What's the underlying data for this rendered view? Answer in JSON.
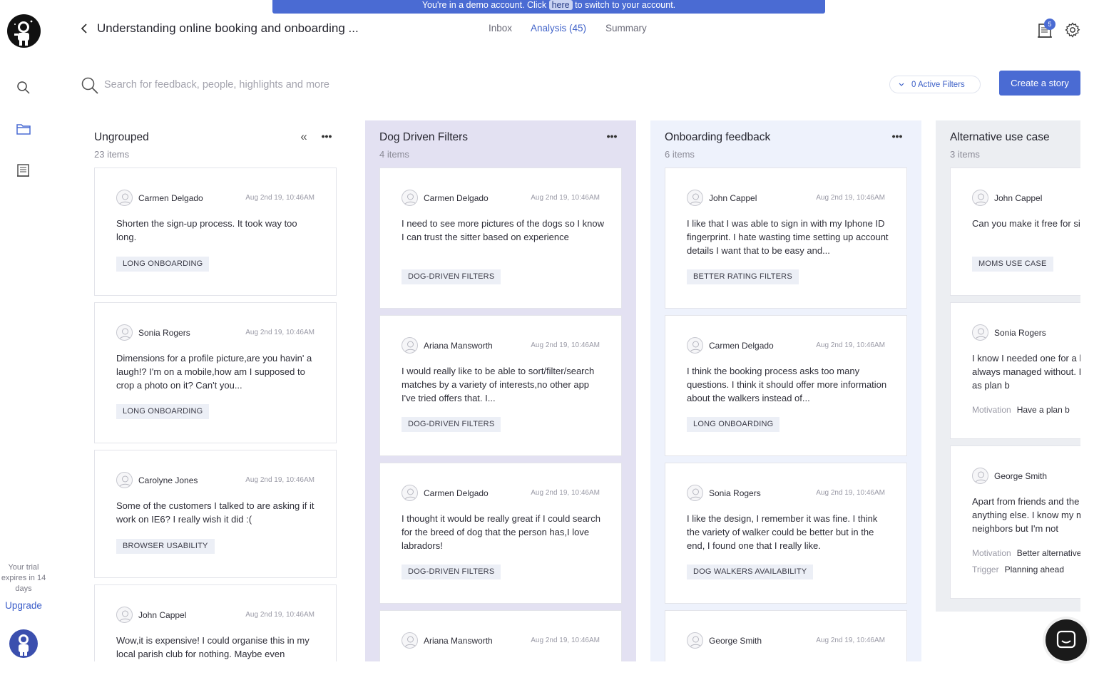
{
  "banner": {
    "text_before": "You're in a demo account. Click",
    "link": "here",
    "text_after": "to switch to your account."
  },
  "header": {
    "title": "Understanding online booking and onboarding ...",
    "tabs": [
      {
        "label": "Inbox",
        "active": false
      },
      {
        "label": "Analysis (45)",
        "active": true
      },
      {
        "label": "Summary",
        "active": false
      }
    ],
    "notification_count": "5"
  },
  "search": {
    "placeholder": "Search for feedback, people, highlights and more",
    "value": ""
  },
  "filters": {
    "label": "0 Active Filters"
  },
  "create_story": {
    "label": "Create a story"
  },
  "sidebar": {
    "trial_text": "Your trial expires in 14 days",
    "upgrade_label": "Upgrade"
  },
  "colors": {
    "accent": "#4a6bd3",
    "col_purple": "#e3e1f2",
    "col_blue": "#eef2fc",
    "col_gray": "#eceef2"
  },
  "columns": [
    {
      "title": "Ungrouped",
      "count": "23 items",
      "cards": [
        {
          "name": "Carmen Delgado",
          "date": "Aug 2nd 19, 10:46AM",
          "text": "Shorten the sign-up process. It took way too long.",
          "tag": "LONG ONBOARDING"
        },
        {
          "name": "Sonia Rogers",
          "date": "Aug 2nd 19, 10:46AM",
          "text": "Dimensions for a profile picture,are you havin' a laugh!? I'm on a mobile,how am I supposed to crop a photo on it? Can't you...",
          "tag": "LONG ONBOARDING"
        },
        {
          "name": "Carolyne Jones",
          "date": "Aug 2nd 19, 10:46AM",
          "text": "Some of the customers I talked to are asking if it work on IE6? I really wish it did :(",
          "tag": "BROWSER USABILITY"
        },
        {
          "name": "John Cappel",
          "date": "Aug 2nd 19, 10:46AM",
          "text": "Wow,it is expensive! I could organise this in my local parish club for nothing. Maybe even"
        }
      ]
    },
    {
      "title": "Dog Driven Filters",
      "count": "4 items",
      "cards": [
        {
          "name": "Carmen Delgado",
          "date": "Aug 2nd 19, 10:46AM",
          "text": "I need to see more pictures of the dogs so I know I can trust the sitter based on experience",
          "tag": "DOG-DRIVEN FILTERS"
        },
        {
          "name": "Ariana Mansworth",
          "date": "Aug 2nd 19, 10:46AM",
          "text": "I would really like to be able to sort/filter/search matches by a variety of interests,no other app I've tried offers that. I...",
          "tag": "DOG-DRIVEN FILTERS"
        },
        {
          "name": "Carmen Delgado",
          "date": "Aug 2nd 19, 10:46AM",
          "text": "I thought it would be really great if I could search for the breed of dog that the person has,I love labradors!",
          "tag": "DOG-DRIVEN FILTERS"
        },
        {
          "name": "Ariana Mansworth",
          "date": "Aug 2nd 19, 10:46AM",
          "text": ""
        }
      ]
    },
    {
      "title": "Onboarding feedback",
      "count": "6 items",
      "cards": [
        {
          "name": "John Cappel",
          "date": "Aug 2nd 19, 10:46AM",
          "text": "I like that I was able to sign in with my Iphone ID fingerprint. I hate wasting time setting up account details I want that to be easy and...",
          "tag": "BETTER RATING FILTERS"
        },
        {
          "name": "Carmen Delgado",
          "date": "Aug 2nd 19, 10:46AM",
          "text": "I think the booking process asks too many questions. I think it should offer more information about the walkers instead of...",
          "tag": "LONG ONBOARDING"
        },
        {
          "name": "Sonia Rogers",
          "date": "Aug 2nd 19, 10:46AM",
          "text": "I like the design, I remember it was fine. I think the variety of walker could be better but in the end, I found one that I really like.",
          "tag": "DOG WALKERS AVAILABILITY"
        },
        {
          "name": "George Smith",
          "date": "Aug 2nd 19, 10:46AM",
          "text": ""
        }
      ]
    },
    {
      "title": "Alternative use case",
      "count": "3 items",
      "cards": [
        {
          "name": "John Cappel",
          "date": "",
          "text": "Can you make it free for single mothers!?",
          "tag": "MOMS USE CASE"
        },
        {
          "name": "Sonia Rogers",
          "date": "",
          "text": "I know I needed one for a long time but have always managed without. I'm glad that I have this as plan b",
          "attrs": [
            {
              "k": "Motivation",
              "v": "Have a plan b"
            }
          ]
        },
        {
          "name": "George Smith",
          "date": "",
          "text": "Apart from friends and the app I haven't tried anything else. I know my mum asks her neighbors but I'm not",
          "attrs": [
            {
              "k": "Motivation",
              "v": "Better alternative"
            },
            {
              "k": "Trigger",
              "v": "Planning ahead"
            }
          ]
        }
      ]
    }
  ]
}
